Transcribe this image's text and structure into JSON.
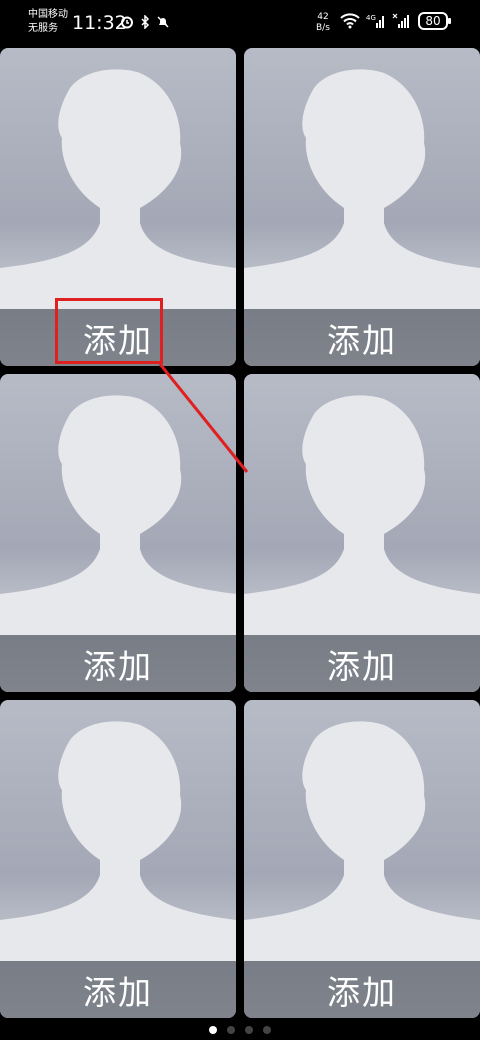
{
  "status_bar": {
    "carrier_line1": "中国移动",
    "carrier_line2": "无服务",
    "time": "11:32",
    "net_speed_value": "42",
    "net_speed_unit": "B/s",
    "network_type": "4G",
    "battery": "80",
    "icons": [
      "alarm-icon",
      "bluetooth-icon",
      "mute-icon",
      "wifi-icon",
      "cellular-signal-icon"
    ]
  },
  "cards": [
    {
      "label": "添加"
    },
    {
      "label": "添加"
    },
    {
      "label": "添加"
    },
    {
      "label": "添加"
    },
    {
      "label": "添加"
    },
    {
      "label": "添加"
    }
  ],
  "page_indicator": {
    "count": 4,
    "active": 1
  },
  "annotation_color": "#e02020"
}
